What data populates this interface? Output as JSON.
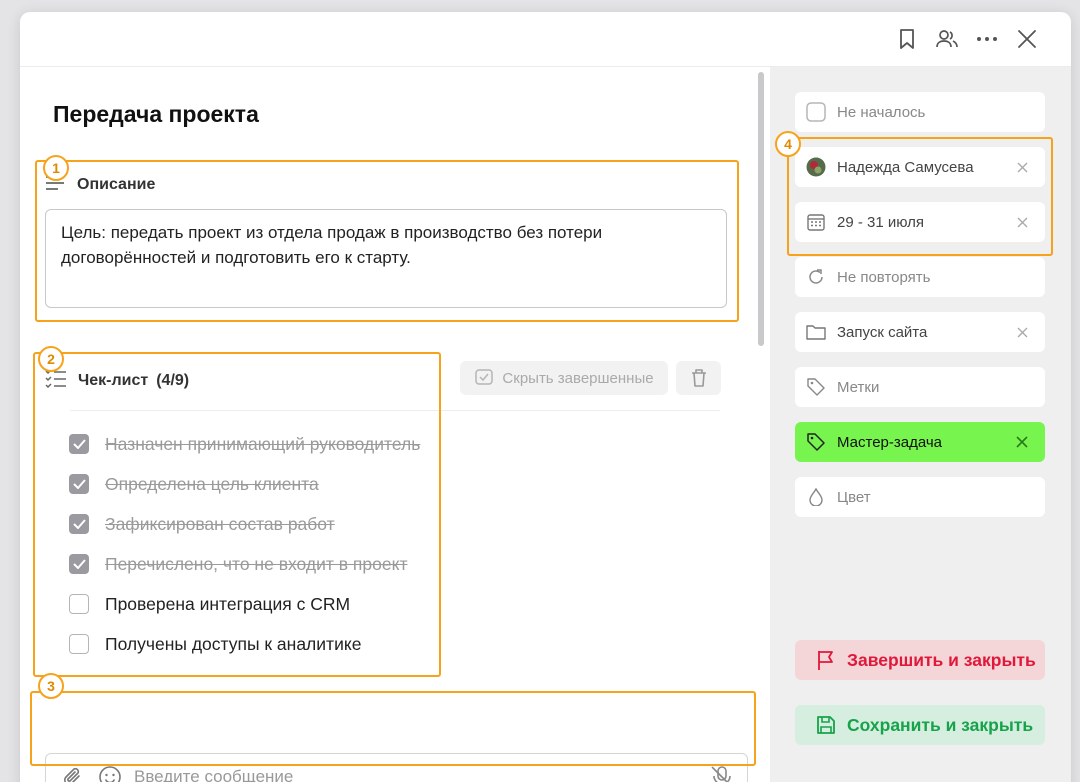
{
  "task": {
    "title": "Передача проекта"
  },
  "description": {
    "heading": "Описание",
    "text": "Цель: передать проект из отдела продаж в производство без потери договорённостей и подготовить его к старту."
  },
  "checklist": {
    "heading": "Чек-лист",
    "count": "(4/9)",
    "hide_completed_label": "Скрыть завершенные",
    "items": [
      {
        "label": "Назначен принимающий руководитель",
        "done": true
      },
      {
        "label": "Определена цель клиента",
        "done": true
      },
      {
        "label": "Зафиксирован состав работ",
        "done": true
      },
      {
        "label": "Перечислено, что не входит в проект",
        "done": true
      },
      {
        "label": "Проверена интеграция с CRM",
        "done": false
      },
      {
        "label": "Получены доступы к аналитике",
        "done": false
      }
    ]
  },
  "composer": {
    "placeholder": "Введите сообщение"
  },
  "sidebar": {
    "status": "Не началось",
    "assignee": "Надежда Самусева",
    "dates": "29 - 31 июля",
    "repeat": "Не повторять",
    "project": "Запуск сайта",
    "tags": "Метки",
    "master_task": "Мастер-задача",
    "color": "Цвет",
    "finish_label": "Завершить и закрыть",
    "save_label": "Сохранить и закрыть"
  },
  "annotations": [
    "1",
    "2",
    "3",
    "4"
  ],
  "colors": {
    "annotation": "#f7a21b",
    "master_task_bg": "#77f54e",
    "finish_bg": "#f4d6d9",
    "finish_text": "#e0183a",
    "save_bg": "#d5eee0",
    "save_text": "#17a34a"
  }
}
